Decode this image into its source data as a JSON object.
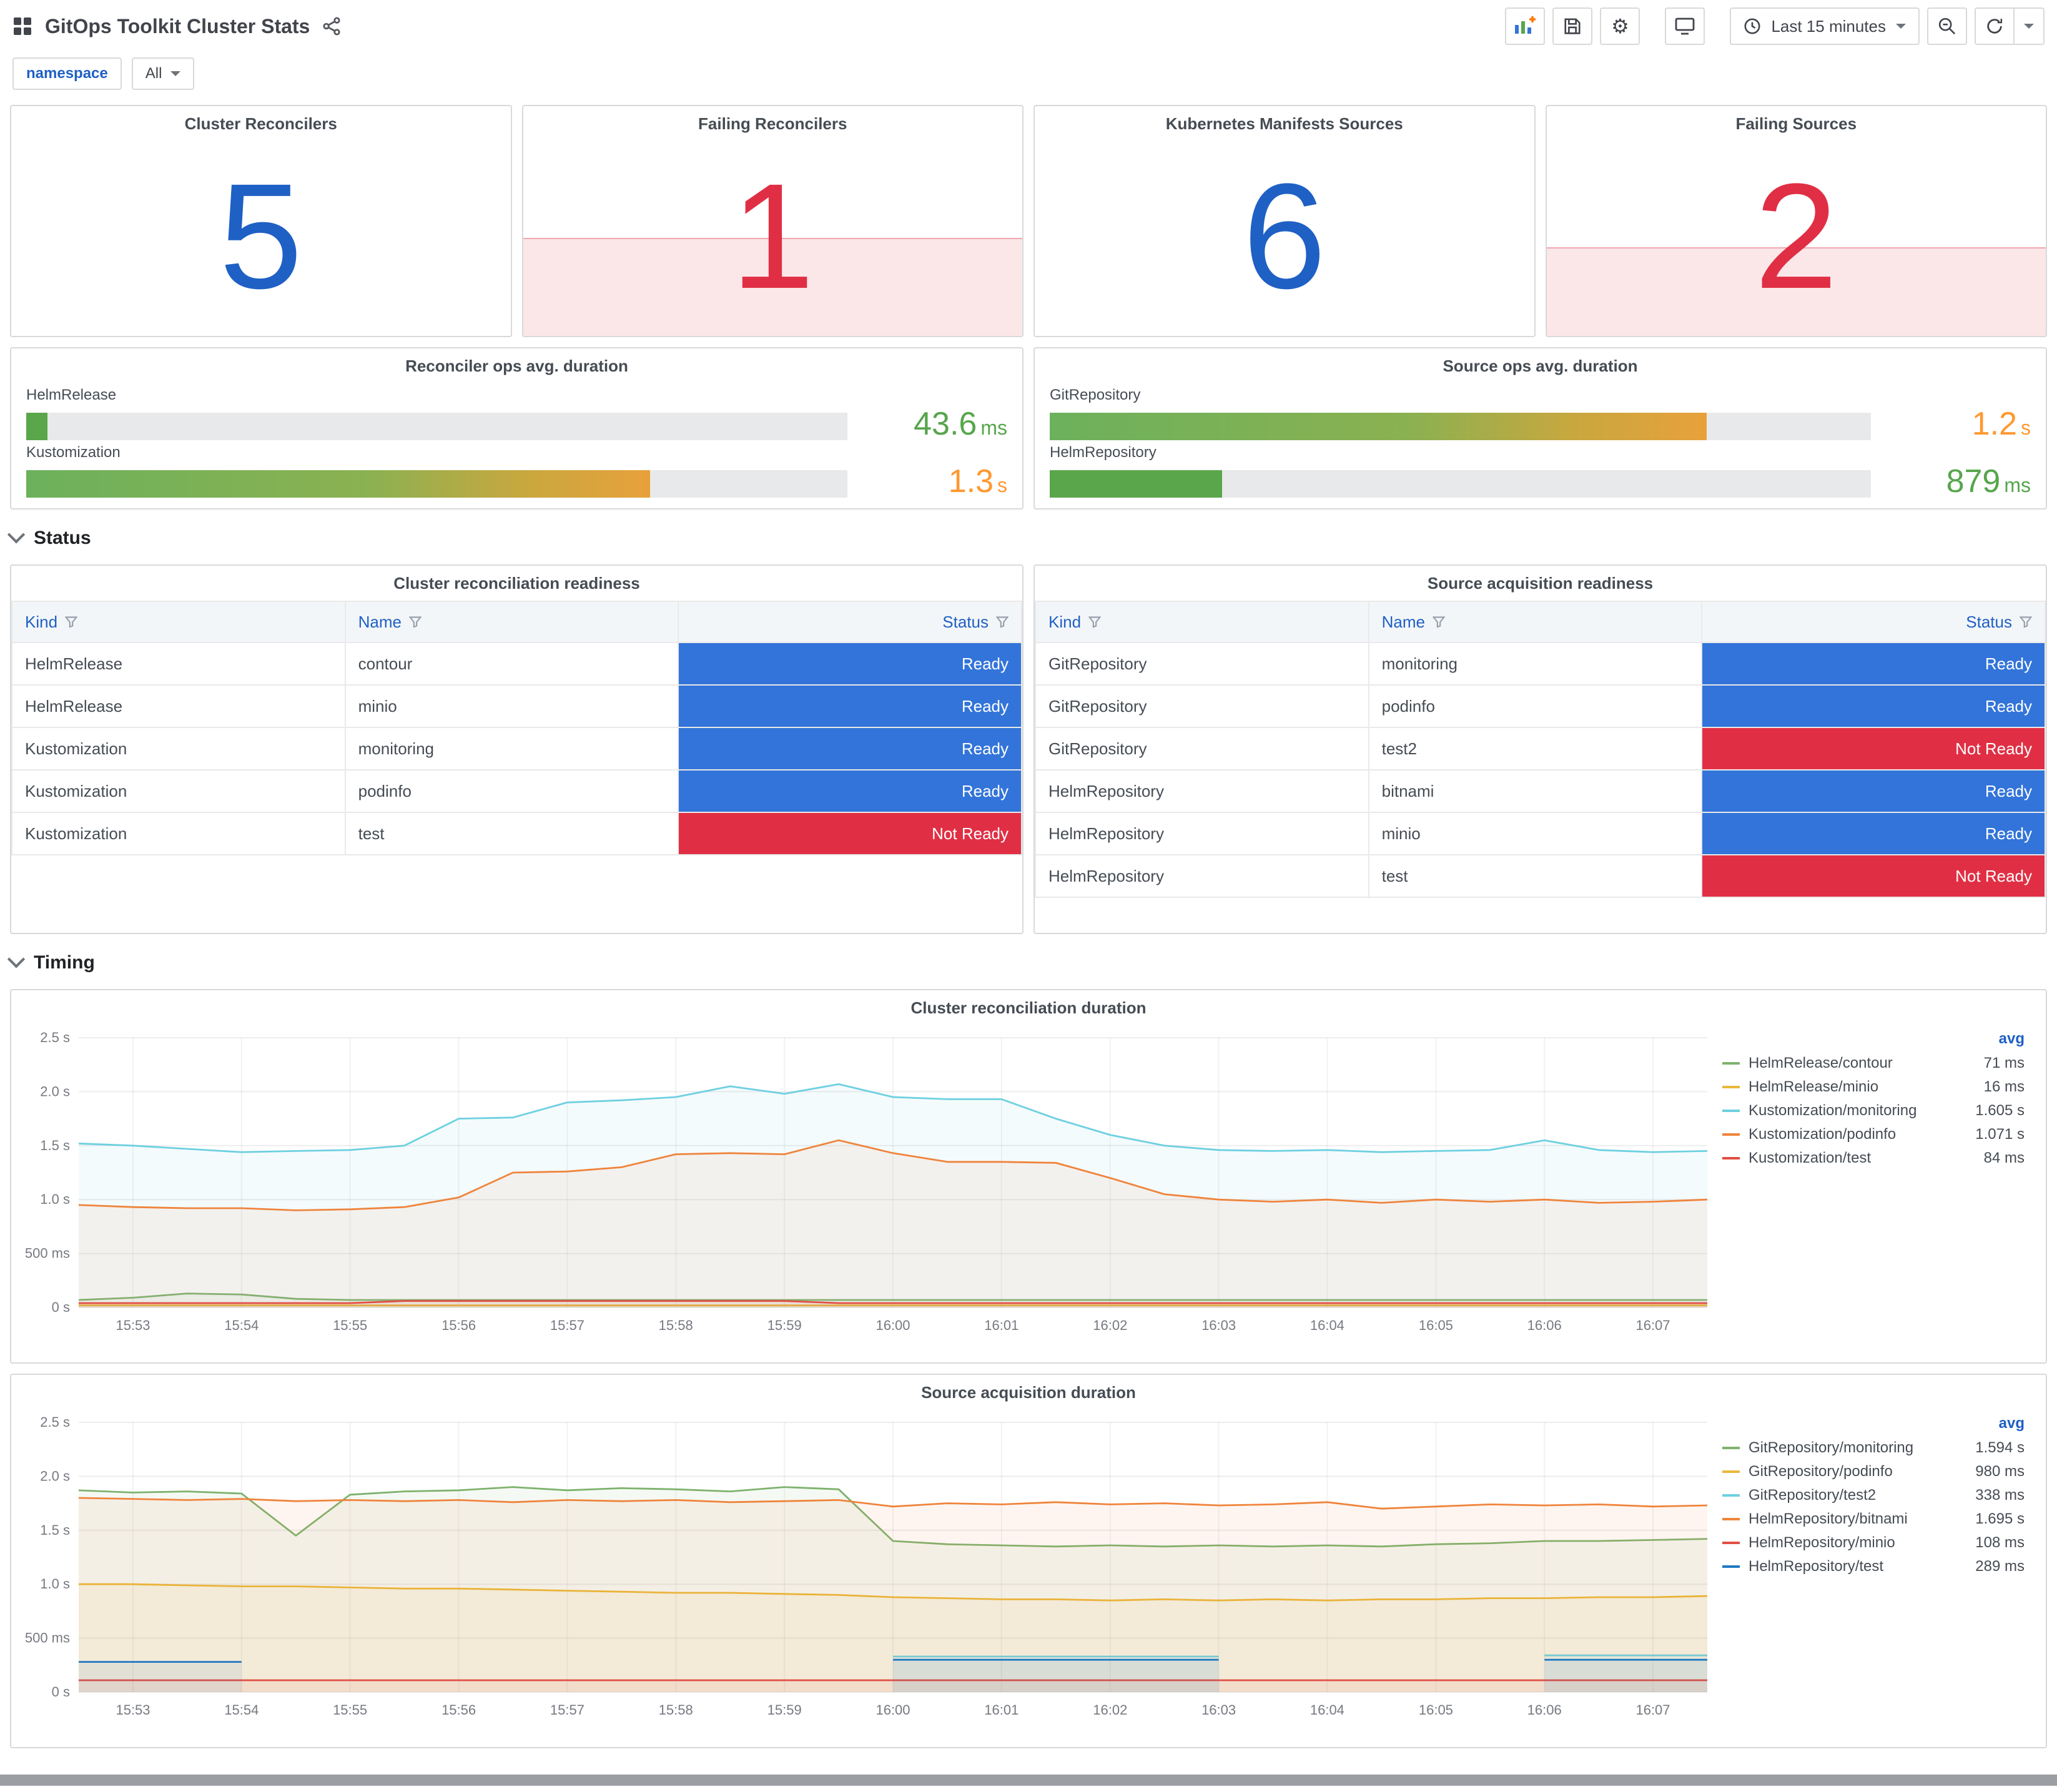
{
  "header": {
    "title": "GitOps Toolkit Cluster Stats",
    "time_range": "Last 15 minutes"
  },
  "variables": {
    "label": "namespace",
    "value": "All"
  },
  "icons": {
    "settings_glyph": "⚙",
    "names": [
      "apps-grid-icon",
      "share-icon",
      "add-panel-icon",
      "save-icon",
      "settings-icon",
      "tv-icon",
      "clock-icon",
      "caret-down-icon",
      "zoom-out-icon",
      "refresh-icon",
      "filter-icon",
      "chevron-down-icon"
    ]
  },
  "sections": {
    "status": "Status",
    "timing": "Timing"
  },
  "stats": [
    {
      "title": "Cluster Reconcilers",
      "value": "5",
      "color": "#1F60C4",
      "band": false,
      "band_pct": 0
    },
    {
      "title": "Failing Reconcilers",
      "value": "1",
      "color": "#E02F44",
      "band": true,
      "band_pct": 42
    },
    {
      "title": "Kubernetes Manifests Sources",
      "value": "6",
      "color": "#1F60C4",
      "band": false,
      "band_pct": 0
    },
    {
      "title": "Failing Sources",
      "value": "2",
      "color": "#E02F44",
      "band": true,
      "band_pct": 38
    }
  ],
  "gauges": [
    {
      "title": "Reconciler ops avg. duration",
      "rows": [
        {
          "label": "HelmRelease",
          "value": "43.6",
          "unit": "ms",
          "pct": 2.6,
          "value_color": "#56A64B"
        },
        {
          "label": "Kustomization",
          "value": "1.3",
          "unit": "s",
          "pct": 76,
          "value_color": "#FF9830"
        }
      ]
    },
    {
      "title": "Source ops avg. duration",
      "rows": [
        {
          "label": "GitRepository",
          "value": "1.2",
          "unit": "s",
          "pct": 80,
          "value_color": "#FF9830"
        },
        {
          "label": "HelmRepository",
          "value": "879",
          "unit": "ms",
          "pct": 21,
          "value_color": "#56A64B"
        }
      ]
    }
  ],
  "tables": [
    {
      "title": "Cluster reconciliation readiness",
      "columns": [
        "Kind",
        "Name",
        "Status"
      ],
      "rows": [
        {
          "kind": "HelmRelease",
          "name": "contour",
          "status": "Ready",
          "status_color": "#3274D9"
        },
        {
          "kind": "HelmRelease",
          "name": "minio",
          "status": "Ready",
          "status_color": "#3274D9"
        },
        {
          "kind": "Kustomization",
          "name": "monitoring",
          "status": "Ready",
          "status_color": "#3274D9"
        },
        {
          "kind": "Kustomization",
          "name": "podinfo",
          "status": "Ready",
          "status_color": "#3274D9"
        },
        {
          "kind": "Kustomization",
          "name": "test",
          "status": "Not Ready",
          "status_color": "#E02F44"
        }
      ]
    },
    {
      "title": "Source acquisition readiness",
      "columns": [
        "Kind",
        "Name",
        "Status"
      ],
      "rows": [
        {
          "kind": "GitRepository",
          "name": "monitoring",
          "status": "Ready",
          "status_color": "#3274D9"
        },
        {
          "kind": "GitRepository",
          "name": "podinfo",
          "status": "Ready",
          "status_color": "#3274D9"
        },
        {
          "kind": "GitRepository",
          "name": "test2",
          "status": "Not Ready",
          "status_color": "#E02F44"
        },
        {
          "kind": "HelmRepository",
          "name": "bitnami",
          "status": "Ready",
          "status_color": "#3274D9"
        },
        {
          "kind": "HelmRepository",
          "name": "minio",
          "status": "Ready",
          "status_color": "#3274D9"
        },
        {
          "kind": "HelmRepository",
          "name": "test",
          "status": "Not Ready",
          "status_color": "#E02F44"
        }
      ]
    }
  ],
  "chart_data": [
    {
      "type": "line",
      "title": "Cluster reconciliation duration",
      "ylim": [
        0,
        2.5
      ],
      "yticks": [
        {
          "value": 0,
          "label": "0 s"
        },
        {
          "value": 0.5,
          "label": "500 ms"
        },
        {
          "value": 1,
          "label": "1.0 s"
        },
        {
          "value": 1.5,
          "label": "1.5 s"
        },
        {
          "value": 2,
          "label": "2.0 s"
        },
        {
          "value": 2.5,
          "label": "2.5 s"
        }
      ],
      "x_labels": [
        "15:53",
        "15:54",
        "15:55",
        "15:56",
        "15:57",
        "15:58",
        "15:59",
        "16:00",
        "16:01",
        "16:02",
        "16:03",
        "16:04",
        "16:05",
        "16:06",
        "16:07"
      ],
      "x_tick_indices": [
        1,
        3,
        5,
        7,
        9,
        11,
        13,
        15,
        17,
        19,
        21,
        23,
        25,
        27,
        29
      ],
      "legend_header": "avg",
      "legend_position": "right",
      "grid": true,
      "series": [
        {
          "name": "HelmRelease/contour",
          "color": "#7EB26D",
          "avg": "71 ms",
          "values": [
            0.07,
            0.09,
            0.13,
            0.12,
            0.08,
            0.07,
            0.07,
            0.07,
            0.07,
            0.07,
            0.07,
            0.07,
            0.07,
            0.07,
            0.07,
            0.07,
            0.07,
            0.07,
            0.07,
            0.07,
            0.07,
            0.07,
            0.07,
            0.07,
            0.07,
            0.07,
            0.07,
            0.07,
            0.07,
            0.07,
            0.07
          ]
        },
        {
          "name": "HelmRelease/minio",
          "color": "#EAB839",
          "avg": "16 ms",
          "values": [
            0.02,
            0.02,
            0.02,
            0.02,
            0.02,
            0.02,
            0.02,
            0.02,
            0.02,
            0.02,
            0.02,
            0.02,
            0.02,
            0.02,
            0.02,
            0.02,
            0.02,
            0.02,
            0.02,
            0.02,
            0.02,
            0.02,
            0.02,
            0.02,
            0.02,
            0.02,
            0.02,
            0.02,
            0.02,
            0.02,
            0.02
          ]
        },
        {
          "name": "Kustomization/monitoring",
          "color": "#6ED0E0",
          "avg": "1.605 s",
          "values": [
            1.52,
            1.5,
            1.47,
            1.44,
            1.45,
            1.46,
            1.5,
            1.75,
            1.76,
            1.9,
            1.92,
            1.95,
            2.05,
            1.98,
            2.07,
            1.95,
            1.93,
            1.93,
            1.75,
            1.6,
            1.5,
            1.46,
            1.45,
            1.46,
            1.44,
            1.45,
            1.46,
            1.55,
            1.46,
            1.44,
            1.45
          ]
        },
        {
          "name": "Kustomization/podinfo",
          "color": "#EF843C",
          "avg": "1.071 s",
          "values": [
            0.95,
            0.93,
            0.92,
            0.92,
            0.9,
            0.91,
            0.93,
            1.02,
            1.25,
            1.26,
            1.3,
            1.42,
            1.43,
            1.42,
            1.55,
            1.43,
            1.35,
            1.35,
            1.34,
            1.2,
            1.05,
            1.0,
            0.98,
            1.0,
            0.97,
            1.0,
            0.98,
            1.0,
            0.97,
            0.98,
            1.0
          ]
        },
        {
          "name": "Kustomization/test",
          "color": "#E24D42",
          "avg": "84 ms",
          "values": [
            0.04,
            0.04,
            0.04,
            0.04,
            0.04,
            0.04,
            0.06,
            0.06,
            0.06,
            0.06,
            0.06,
            0.06,
            0.06,
            0.06,
            0.04,
            0.04,
            0.04,
            0.04,
            0.04,
            0.04,
            0.04,
            0.04,
            0.04,
            0.04,
            0.04,
            0.04,
            0.04,
            0.04,
            0.04,
            0.04,
            0.04
          ]
        }
      ]
    },
    {
      "type": "line",
      "title": "Source acquisition duration",
      "ylim": [
        0,
        2.5
      ],
      "yticks": [
        {
          "value": 0,
          "label": "0 s"
        },
        {
          "value": 0.5,
          "label": "500 ms"
        },
        {
          "value": 1,
          "label": "1.0 s"
        },
        {
          "value": 1.5,
          "label": "1.5 s"
        },
        {
          "value": 2,
          "label": "2.0 s"
        },
        {
          "value": 2.5,
          "label": "2.5 s"
        }
      ],
      "x_labels": [
        "15:53",
        "15:54",
        "15:55",
        "15:56",
        "15:57",
        "15:58",
        "15:59",
        "16:00",
        "16:01",
        "16:02",
        "16:03",
        "16:04",
        "16:05",
        "16:06",
        "16:07"
      ],
      "x_tick_indices": [
        1,
        3,
        5,
        7,
        9,
        11,
        13,
        15,
        17,
        19,
        21,
        23,
        25,
        27,
        29
      ],
      "legend_header": "avg",
      "legend_position": "right",
      "grid": true,
      "series": [
        {
          "name": "GitRepository/monitoring",
          "color": "#7EB26D",
          "avg": "1.594 s",
          "values": [
            1.87,
            1.85,
            1.86,
            1.84,
            1.45,
            1.83,
            1.86,
            1.87,
            1.9,
            1.87,
            1.89,
            1.88,
            1.86,
            1.9,
            1.88,
            1.4,
            1.37,
            1.36,
            1.35,
            1.36,
            1.35,
            1.36,
            1.35,
            1.36,
            1.35,
            1.37,
            1.38,
            1.4,
            1.4,
            1.41,
            1.42
          ]
        },
        {
          "name": "GitRepository/podinfo",
          "color": "#EAB839",
          "avg": "980 ms",
          "values": [
            1.0,
            1.0,
            0.99,
            0.98,
            0.98,
            0.97,
            0.96,
            0.96,
            0.95,
            0.94,
            0.93,
            0.92,
            0.92,
            0.91,
            0.9,
            0.88,
            0.87,
            0.86,
            0.86,
            0.85,
            0.86,
            0.85,
            0.86,
            0.85,
            0.86,
            0.86,
            0.87,
            0.87,
            0.88,
            0.88,
            0.89
          ]
        },
        {
          "name": "GitRepository/test2",
          "color": "#6ED0E0",
          "avg": "338 ms",
          "values": [
            null,
            null,
            null,
            null,
            null,
            null,
            null,
            null,
            null,
            null,
            null,
            null,
            null,
            null,
            null,
            0.33,
            0.33,
            0.33,
            0.33,
            0.33,
            0.33,
            0.33,
            null,
            null,
            null,
            null,
            null,
            0.34,
            0.34,
            0.34,
            0.34
          ]
        },
        {
          "name": "HelmRepository/bitnami",
          "color": "#EF843C",
          "avg": "1.695 s",
          "values": [
            1.8,
            1.79,
            1.78,
            1.79,
            1.77,
            1.78,
            1.77,
            1.78,
            1.76,
            1.78,
            1.77,
            1.78,
            1.76,
            1.77,
            1.78,
            1.72,
            1.75,
            1.74,
            1.76,
            1.74,
            1.75,
            1.73,
            1.74,
            1.76,
            1.7,
            1.72,
            1.74,
            1.73,
            1.74,
            1.72,
            1.73
          ]
        },
        {
          "name": "HelmRepository/minio",
          "color": "#E24D42",
          "avg": "108 ms",
          "values": [
            0.11,
            0.11,
            0.11,
            0.11,
            0.11,
            0.11,
            0.11,
            0.11,
            0.11,
            0.11,
            0.11,
            0.11,
            0.11,
            0.11,
            0.11,
            0.11,
            0.11,
            0.11,
            0.11,
            0.11,
            0.11,
            0.11,
            0.11,
            0.11,
            0.11,
            0.11,
            0.11,
            0.11,
            0.11,
            0.11,
            0.11
          ]
        },
        {
          "name": "HelmRepository/test",
          "color": "#1F78C1",
          "avg": "289 ms",
          "values": [
            0.28,
            0.28,
            0.28,
            0.28,
            null,
            null,
            null,
            null,
            null,
            null,
            null,
            null,
            null,
            null,
            null,
            0.3,
            0.3,
            0.3,
            0.3,
            0.3,
            0.3,
            0.3,
            null,
            null,
            null,
            null,
            null,
            0.3,
            0.3,
            0.3,
            0.3
          ]
        }
      ]
    }
  ]
}
